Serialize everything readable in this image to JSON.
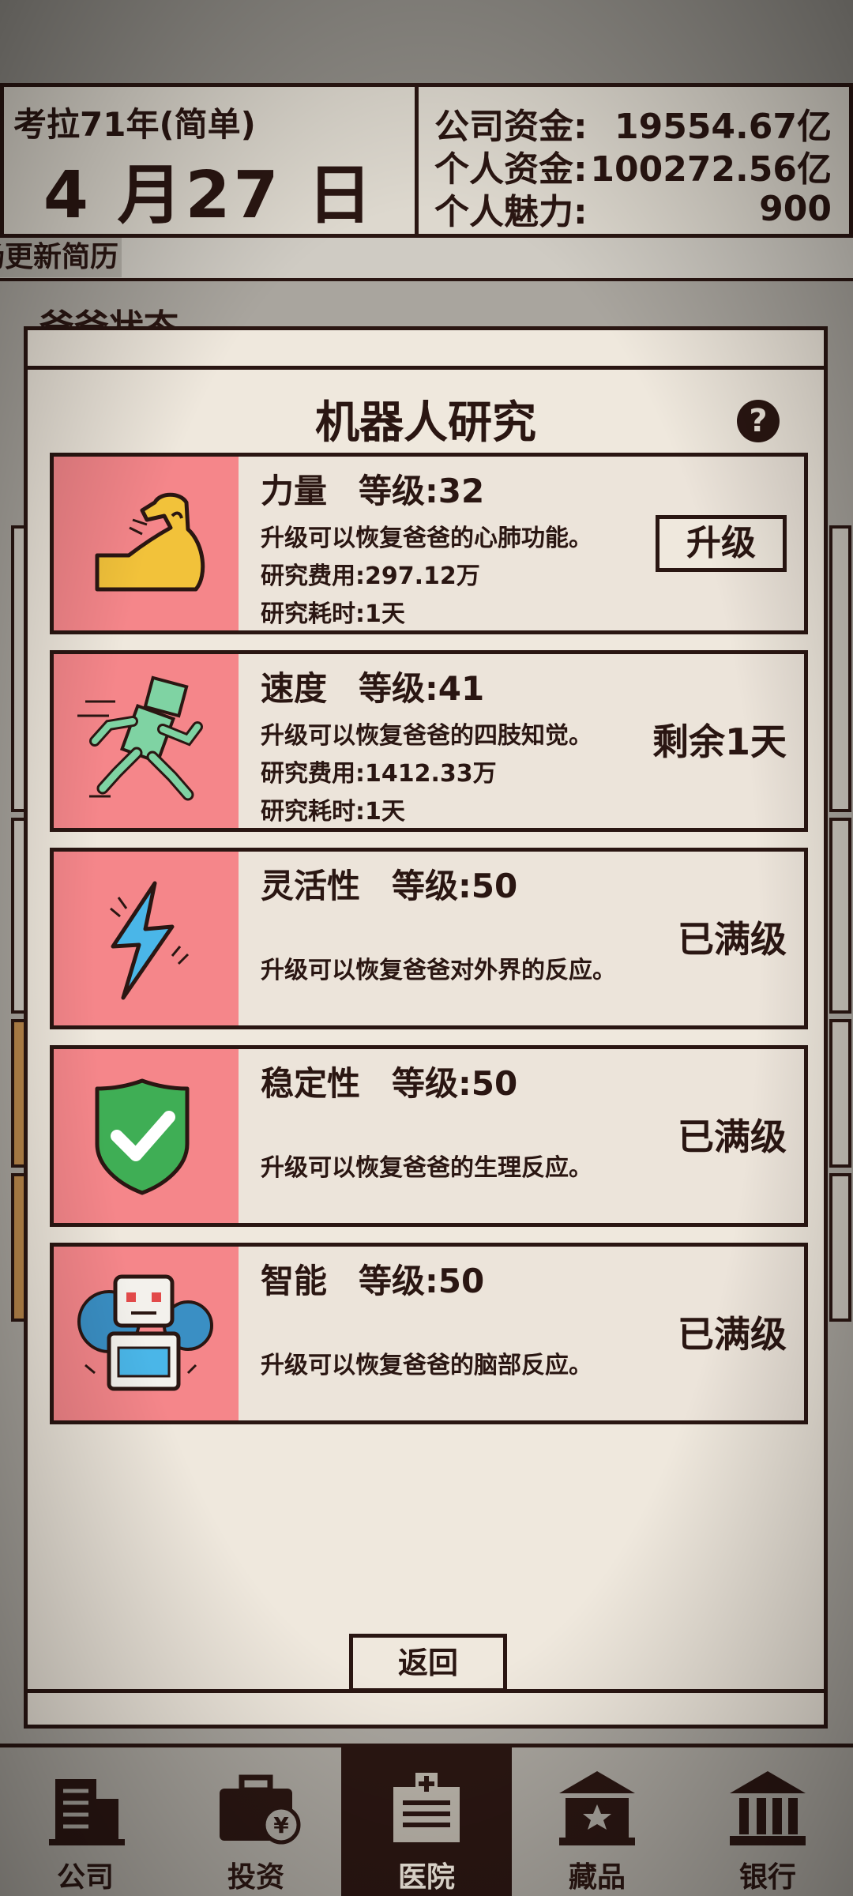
{
  "header": {
    "year_label": "考拉71年(简单)",
    "date": "4 月27 日",
    "company_funds_label": "公司资金:",
    "company_funds_value": "19554.67亿",
    "personal_funds_label": "个人资金:",
    "personal_funds_value": "100272.56亿",
    "charm_label": "个人魅力:",
    "charm_value": "900"
  },
  "ticker": {
    "text": "场更新简历"
  },
  "background": {
    "section_title": "爸爸状态"
  },
  "modal": {
    "title": "机器人研究",
    "help_icon": "question-circle-icon",
    "cards": [
      {
        "name": "力量",
        "level": "等级:32",
        "desc": "升级可以恢复爸爸的心肺功能。",
        "cost": "研究费用:297.12万",
        "time": "研究耗时:1天",
        "action": "升级",
        "icon": "flexed-arm-icon"
      },
      {
        "name": "速度",
        "level": "等级:41",
        "desc": "升级可以恢复爸爸的四肢知觉。",
        "cost": "研究费用:1412.33万",
        "time": "研究耗时:1天",
        "action": "剩余1天",
        "icon": "running-robot-icon"
      },
      {
        "name": "灵活性",
        "level": "等级:50",
        "desc": "升级可以恢复爸爸对外界的反应。",
        "action": "已满级",
        "icon": "lightning-icon"
      },
      {
        "name": "稳定性",
        "level": "等级:50",
        "desc": "升级可以恢复爸爸的生理反应。",
        "action": "已满级",
        "icon": "shield-check-icon"
      },
      {
        "name": "智能",
        "level": "等级:50",
        "desc": "升级可以恢复爸爸的脑部反应。",
        "action": "已满级",
        "icon": "robot-gear-icon"
      }
    ],
    "back_label": "返回"
  },
  "nav": {
    "items": [
      {
        "label": "公司",
        "icon": "building-icon"
      },
      {
        "label": "投资",
        "icon": "briefcase-yen-icon"
      },
      {
        "label": "医院",
        "icon": "hospital-icon",
        "active": true
      },
      {
        "label": "藏品",
        "icon": "museum-star-icon"
      },
      {
        "label": "银行",
        "icon": "bank-icon"
      }
    ]
  },
  "colors": {
    "ink": "#2a1612",
    "panel": "#efe8dd",
    "card_image_bg": "#f5868a",
    "nav_bg": "#a9a59e"
  }
}
